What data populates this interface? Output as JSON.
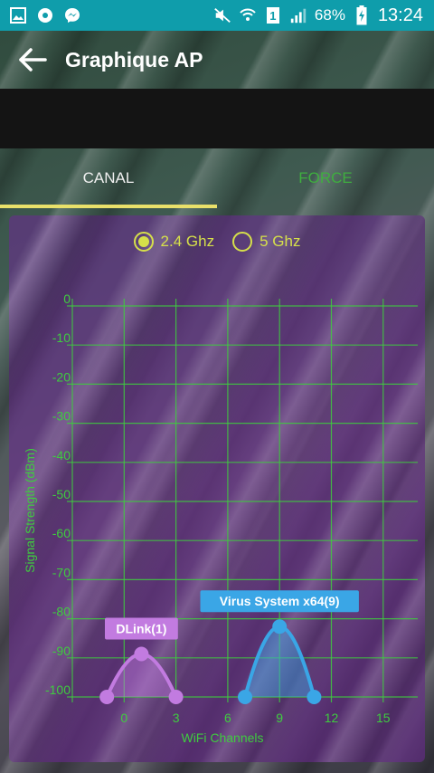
{
  "status_bar": {
    "battery": "68%",
    "time": "13:24",
    "sim": "1",
    "icons": [
      "gallery-icon",
      "soccer-icon",
      "messenger-icon",
      "mute-icon",
      "wifi-icon",
      "sim-icon",
      "signal-icon",
      "battery-icon"
    ]
  },
  "toolbar": {
    "title": "Graphique AP",
    "back_icon": "arrow-left-icon"
  },
  "tabs": [
    {
      "label": "CANAL",
      "selected": true
    },
    {
      "label": "FORCE",
      "selected": false
    }
  ],
  "band_selector": {
    "options": [
      {
        "label": "2.4 Ghz",
        "selected": true
      },
      {
        "label": "5 Ghz",
        "selected": false
      }
    ]
  },
  "colors": {
    "status_bar": "#0f9dab",
    "accent_yellow": "#d6e04a",
    "grid_green": "#3fcc3f",
    "dlink": "#c27be0",
    "virus": "#3aa6e6"
  },
  "chart_data": {
    "type": "area",
    "xlabel": "WiFi Channels",
    "ylabel": "Signal Strength (dBm)",
    "xlim": [
      -3,
      17
    ],
    "ylim": [
      -100,
      0
    ],
    "x_ticks": [
      0,
      3,
      6,
      9,
      12,
      15
    ],
    "y_ticks": [
      0,
      -10,
      -20,
      -30,
      -40,
      -50,
      -60,
      -70,
      -80,
      -90,
      -100
    ],
    "grid": true,
    "series": [
      {
        "name": "DLink(1)",
        "x": [
          -1,
          1,
          3
        ],
        "y": [
          -100,
          -89,
          -100
        ],
        "color": "#c27be0"
      },
      {
        "name": "Virus System x64(9)",
        "x": [
          7,
          9,
          11
        ],
        "y": [
          -100,
          -82,
          -100
        ],
        "color": "#3aa6e6"
      }
    ]
  }
}
